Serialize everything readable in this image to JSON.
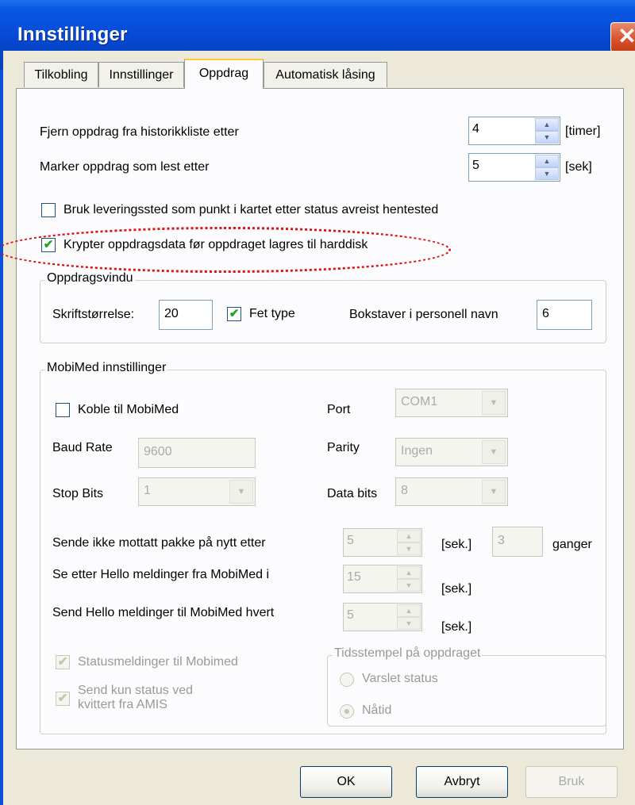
{
  "window": {
    "title": "Innstillinger",
    "close_glyph": "✕"
  },
  "tabs": [
    {
      "label": "Tilkobling",
      "active": false
    },
    {
      "label": "Innstillinger",
      "active": false
    },
    {
      "label": "Oppdrag",
      "active": true
    },
    {
      "label": "Automatisk låsing",
      "active": false
    }
  ],
  "history": {
    "label": "Fjern oppdrag fra historikkliste etter",
    "value": "4",
    "unit": "[timer]"
  },
  "markread": {
    "label": "Marker oppdrag som lest etter",
    "value": "5",
    "unit": "[sek]"
  },
  "check_delivery": {
    "label": "Bruk leveringssted som punkt i kartet etter status avreist hentested",
    "checked": false
  },
  "check_encrypt": {
    "label": "Krypter oppdragsdata før oppdraget lagres til harddisk",
    "checked": true
  },
  "oppdragsvindu": {
    "legend": "Oppdragsvindu",
    "font_size_label": "Skriftstørrelse:",
    "font_size_value": "20",
    "bold_label": "Fet type",
    "bold_checked": true,
    "letters_label": "Bokstaver i personell navn",
    "letters_value": "6"
  },
  "mobimed": {
    "legend": "MobiMed innstillinger",
    "connect_label": "Koble til MobiMed",
    "connect_checked": false,
    "port_label": "Port",
    "port_value": "COM1",
    "baud_label": "Baud Rate",
    "baud_value": "9600",
    "parity_label": "Parity",
    "parity_value": "Ingen",
    "stopbits_label": "Stop Bits",
    "stopbits_value": "1",
    "databits_label": "Data bits",
    "databits_value": "8",
    "resend_label": "Sende ikke mottatt pakke på nytt etter",
    "resend_value": "5",
    "resend_unit": "[sek.]",
    "resend_times_value": "3",
    "resend_times_unit": "ganger",
    "hello_watch_label": "Se etter Hello meldinger fra MobiMed i",
    "hello_watch_value": "15",
    "hello_watch_unit": "[sek.]",
    "hello_send_label": "Send Hello meldinger til MobiMed hvert",
    "hello_send_value": "5",
    "hello_send_unit": "[sek.]",
    "status_label": "Statusmeldinger til Mobimed",
    "status_checked": true,
    "send_only_label_1": "Send kun status ved",
    "send_only_label_2": "kvittert fra AMIS",
    "send_only_checked": true,
    "timestamp_legend": "Tidsstempel på oppdraget",
    "radio_notified": "Varslet status",
    "radio_notified_selected": false,
    "radio_now": "Nåtid",
    "radio_now_selected": true
  },
  "buttons": {
    "ok": "OK",
    "cancel": "Avbryt",
    "apply": "Bruk"
  },
  "icons": {
    "up": "▲",
    "down": "▼",
    "check": "✔"
  }
}
